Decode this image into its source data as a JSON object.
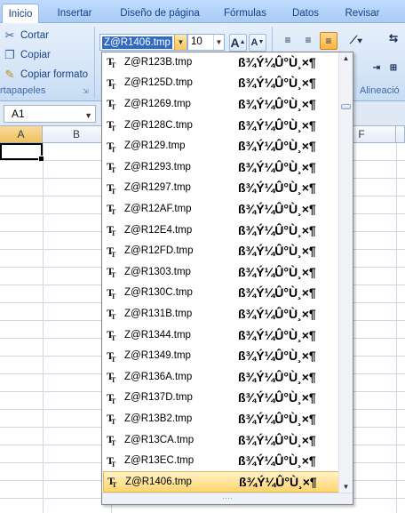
{
  "tabs": [
    "Inicio",
    "Insertar",
    "Diseño de página",
    "Fórmulas",
    "Datos",
    "Revisar"
  ],
  "clipboard": {
    "cut_label": "Cortar",
    "copy_label": "Copiar",
    "format_painter_label": "Copiar formato",
    "group_label": "rtapapeles"
  },
  "font": {
    "name_value": "Z@R1406.tmp",
    "size_value": "10",
    "grow_label": "A",
    "shrink_label": "A"
  },
  "alignment": {
    "group_label": "Alineació"
  },
  "formula_bar": {
    "name_box": "A1"
  },
  "columns": [
    "A",
    "B",
    "F"
  ],
  "font_list": {
    "sample_text": "ß¾Ý¼Û°Ù¸×¶",
    "items": [
      "Z@R123B.tmp",
      "Z@R125D.tmp",
      "Z@R1269.tmp",
      "Z@R128C.tmp",
      "Z@R129.tmp",
      "Z@R1293.tmp",
      "Z@R1297.tmp",
      "Z@R12AF.tmp",
      "Z@R12E4.tmp",
      "Z@R12FD.tmp",
      "Z@R1303.tmp",
      "Z@R130C.tmp",
      "Z@R131B.tmp",
      "Z@R1344.tmp",
      "Z@R1349.tmp",
      "Z@R136A.tmp",
      "Z@R137D.tmp",
      "Z@R13B2.tmp",
      "Z@R13CA.tmp",
      "Z@R13EC.tmp",
      "Z@R1406.tmp"
    ],
    "selected": "Z@R1406.tmp"
  }
}
